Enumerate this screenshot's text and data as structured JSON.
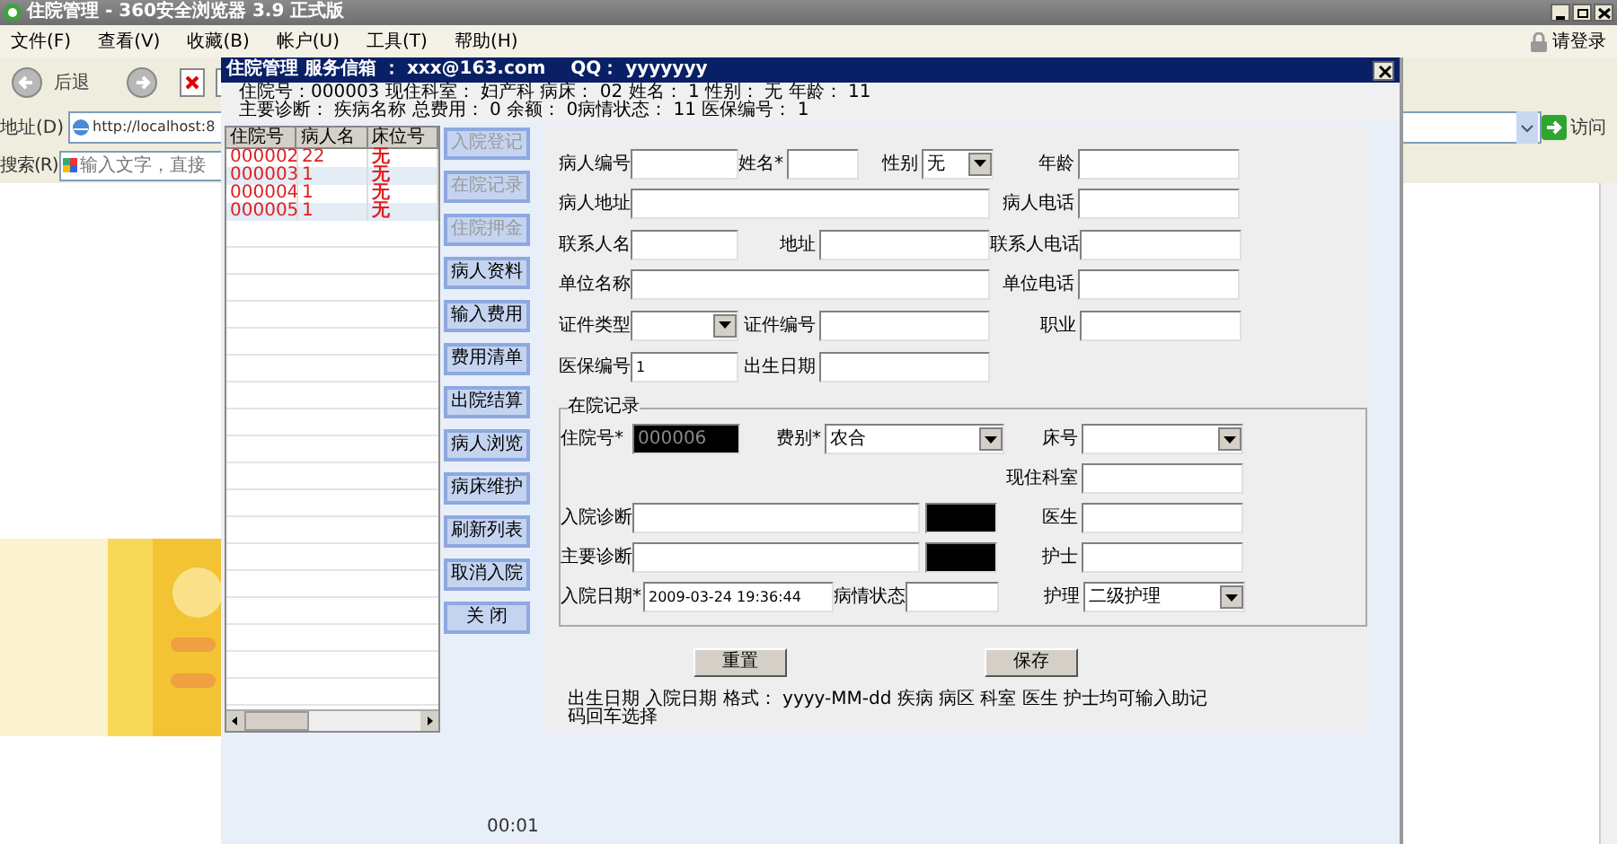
{
  "browser": {
    "title": "住院管理 - 360安全浏览器 3.9 正式版",
    "menu": [
      "文件(F)",
      "查看(V)",
      "收藏(B)",
      "帐户(U)",
      "工具(T)",
      "帮助(H)"
    ],
    "login": "请登录",
    "back": "后退",
    "address_label": "地址(D)",
    "address_value": "http://localhost:8",
    "go": "访问",
    "search_label": "搜索(R)",
    "search_placeholder": "输入文字，直接",
    "timer": "00:01"
  },
  "dialog": {
    "title": "住院管理 服务信箱 ： xxx@163.com    QQ： yyyyyyy",
    "info": [
      "住院号：000003 现住科室： 妇产科 病床： 02 姓名： 1 性别： 无 年龄： 11",
      "主要诊断： 疾病名称 总费用： 0 余额： 0病情状态： 11 医保编号： 1"
    ],
    "table": {
      "columns": [
        "住院号",
        "病人名",
        "床位号"
      ],
      "rows": [
        {
          "cells": [
            "000002",
            "22",
            "无"
          ],
          "selected": false
        },
        {
          "cells": [
            "000003",
            "1",
            "无"
          ],
          "selected": true
        },
        {
          "cells": [
            "000004",
            "1",
            "无"
          ],
          "selected": false
        },
        {
          "cells": [
            "000005",
            "1",
            "无"
          ],
          "selected": true
        }
      ]
    },
    "buttons": [
      {
        "label": "入院登记",
        "disabled": true
      },
      {
        "label": "在院记录",
        "disabled": true
      },
      {
        "label": "住院押金",
        "disabled": true
      },
      {
        "label": "病人资料",
        "disabled": false
      },
      {
        "label": "输入费用",
        "disabled": false
      },
      {
        "label": "费用清单",
        "disabled": false
      },
      {
        "label": "出院结算",
        "disabled": false
      },
      {
        "label": "病人浏览",
        "disabled": false
      },
      {
        "label": "病床维护",
        "disabled": false
      },
      {
        "label": "刷新列表",
        "disabled": false
      },
      {
        "label": "取消入院",
        "disabled": false
      },
      {
        "label": "关 闭",
        "disabled": false
      }
    ],
    "patient_rows": [
      [
        {
          "label": "病人编号",
          "kind": "text"
        },
        {
          "label": "姓名*",
          "kind": "text"
        },
        {
          "label": "性别",
          "kind": "select",
          "value": "无"
        },
        {
          "label": "年龄",
          "kind": "text"
        }
      ],
      [
        {
          "label": "病人地址",
          "kind": "text"
        },
        {
          "label": "病人电话",
          "kind": "text"
        }
      ],
      [
        {
          "label": "联系人名",
          "kind": "text"
        },
        {
          "label": "地址",
          "kind": "text"
        },
        {
          "label": "联系人电话",
          "kind": "text"
        }
      ],
      [
        {
          "label": "单位名称",
          "kind": "text"
        },
        {
          "label": "单位电话",
          "kind": "text"
        }
      ],
      [
        {
          "label": "证件类型",
          "kind": "select"
        },
        {
          "label": "证件编号",
          "kind": "text"
        },
        {
          "label": "职业",
          "kind": "text"
        }
      ],
      [
        {
          "label": "医保编号",
          "kind": "text",
          "value": "1"
        },
        {
          "label": "出生日期",
          "kind": "text"
        }
      ]
    ],
    "record": {
      "legend": "在院记录",
      "rows": [
        [
          {
            "label": "住院号*",
            "kind": "dark",
            "value": "000006"
          },
          {
            "label": "费别*",
            "kind": "select",
            "value": "农合"
          },
          {
            "label": "床号",
            "kind": "select"
          }
        ],
        [
          {
            "kind": "blank"
          },
          {
            "kind": "blank"
          },
          {
            "label": "现住科室",
            "kind": "text"
          }
        ],
        [
          {
            "label": "入院诊断",
            "kind": "text"
          },
          {
            "kind": "dark"
          },
          {
            "label": "医生",
            "kind": "text"
          }
        ],
        [
          {
            "label": "主要诊断",
            "kind": "text"
          },
          {
            "kind": "dark"
          },
          {
            "label": "护士",
            "kind": "text"
          }
        ],
        [
          {
            "label": "入院日期*",
            "kind": "text",
            "value": "2009-03-24 19:36:44"
          },
          {
            "label": "病情状态",
            "kind": "text"
          },
          {
            "label": "护理",
            "kind": "select",
            "value": "二级护理"
          }
        ]
      ]
    },
    "actions": [
      "重置",
      "保存"
    ],
    "note": "出生日期 入院日期 格式： yyyy-MM-dd        疾病 病区 科室 医生 护士均可输入助记码回车选择"
  }
}
